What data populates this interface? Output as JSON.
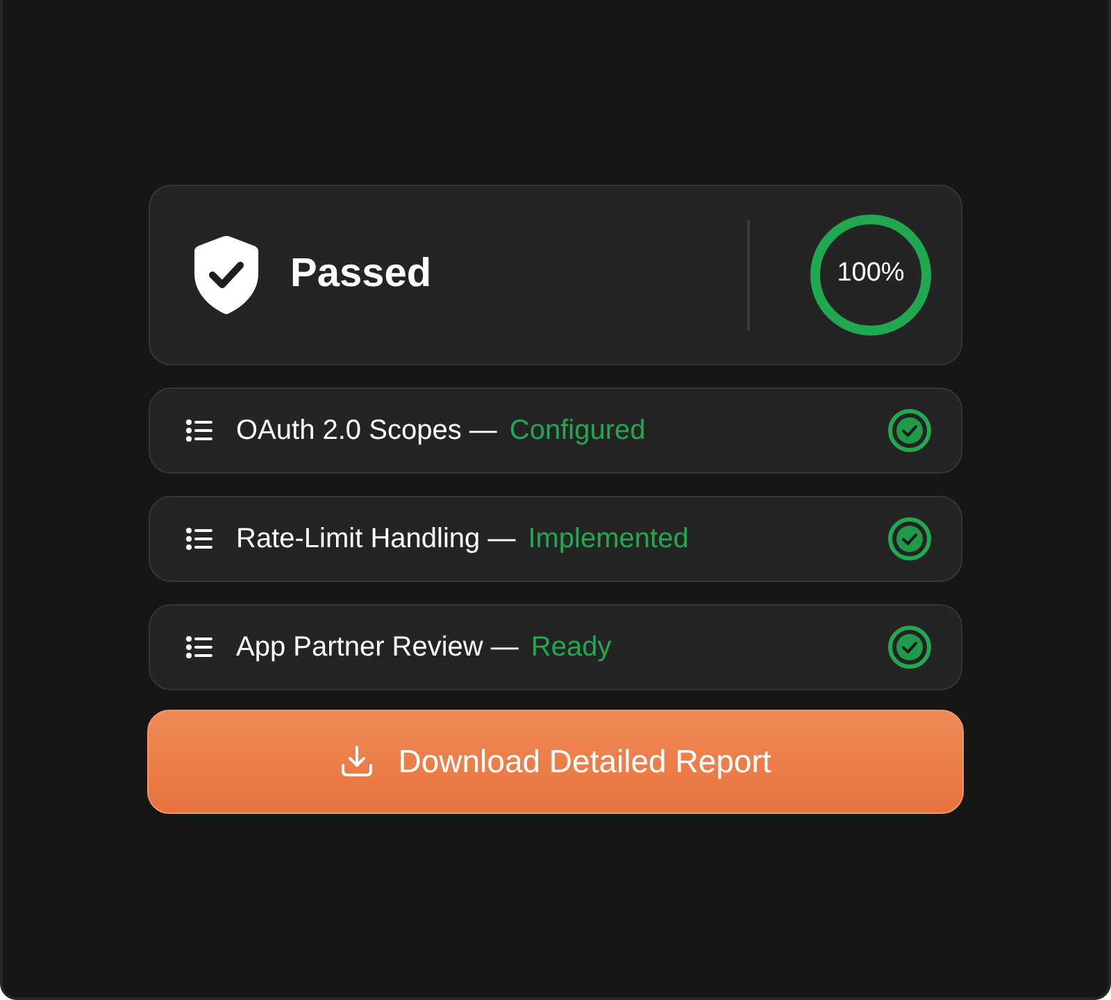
{
  "summary": {
    "title": "Passed",
    "score": "100%",
    "level": 1
  },
  "checks": [
    {
      "label": "OAuth 2.0 Scopes —",
      "status": "Configured"
    },
    {
      "label": "Rate-Limit Handling —",
      "status": "Implemented"
    },
    {
      "label": "App Partner Review —",
      "status": "Ready"
    }
  ],
  "action": {
    "label": "Download Detailed Report"
  }
}
